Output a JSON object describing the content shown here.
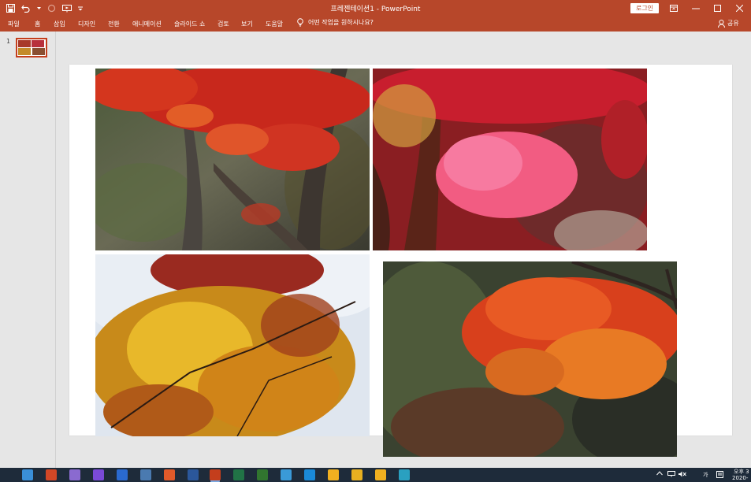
{
  "window": {
    "title": "프레젠테이션1  -  PowerPoint",
    "login_label": "로그인"
  },
  "ribbon": {
    "tabs": [
      "파일",
      "홈",
      "삽입",
      "디자인",
      "전환",
      "애니메이션",
      "슬라이드 쇼",
      "검토",
      "보기",
      "도움말"
    ],
    "tell_me": "어떤 작업을 원하시나요?",
    "share": "공유"
  },
  "thumbnails": {
    "slide_number": "1"
  },
  "tray": {
    "time": "오후 3",
    "date": "2020-1",
    "ime": "가"
  },
  "colors": {
    "accent": "#b7472a",
    "taskbar": "#1e2b3a"
  },
  "taskbar_icons": [
    "photos-icon",
    "office-icon",
    "chrome-like-icon",
    "save-icon",
    "chat-icon",
    "window-icon",
    "paint-icon",
    "word-icon",
    "powerpoint-icon",
    "excel-icon",
    "publisher-icon",
    "bird-icon",
    "edge-icon",
    "chrome-icon",
    "folder-icon",
    "chrome-icon-2",
    "globe-icon"
  ]
}
